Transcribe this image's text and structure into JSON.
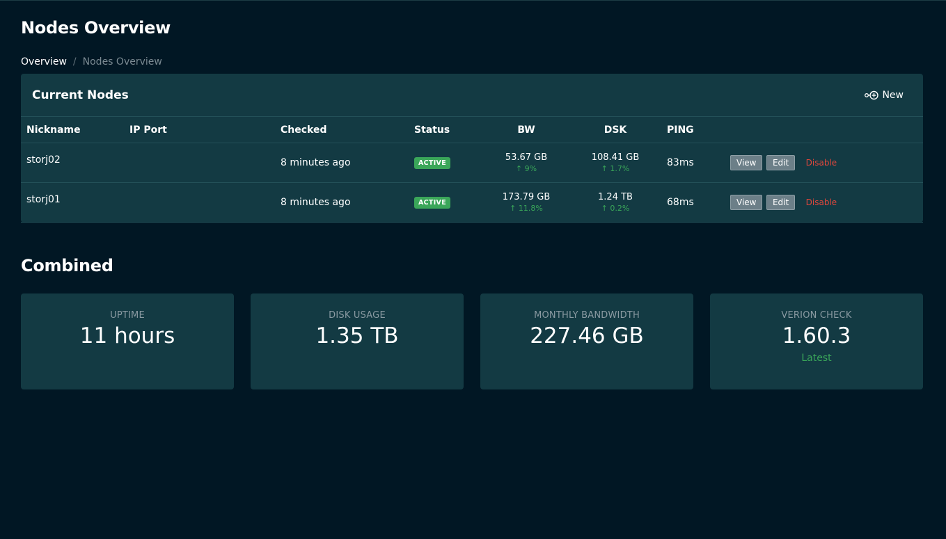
{
  "header": {
    "title": "Nodes Overview"
  },
  "breadcrumb": {
    "home": "Overview",
    "separator": "/",
    "current": "Nodes Overview"
  },
  "nodes_card": {
    "title": "Current Nodes",
    "new_label": "New",
    "columns": {
      "nickname": "Nickname",
      "ip_port": "IP Port",
      "checked": "Checked",
      "status": "Status",
      "bw": "BW",
      "dsk": "DSK",
      "ping": "PING"
    },
    "rows": [
      {
        "nickname": "storj02",
        "ip_port": "",
        "checked": "8 minutes ago",
        "status": "ACTIVE",
        "bw": "53.67 GB",
        "bw_change": "↑ 9%",
        "dsk": "108.41 GB",
        "dsk_change": "↑ 1.7%",
        "ping": "83ms",
        "view": "View",
        "edit": "Edit",
        "disable": "Disable"
      },
      {
        "nickname": "storj01",
        "ip_port": "",
        "checked": "8 minutes ago",
        "status": "ACTIVE",
        "bw": "173.79 GB",
        "bw_change": "↑ 11.8%",
        "dsk": "1.24 TB",
        "dsk_change": "↑ 0.2%",
        "ping": "68ms",
        "view": "View",
        "edit": "Edit",
        "disable": "Disable"
      }
    ]
  },
  "combined": {
    "title": "Combined",
    "stats": [
      {
        "label": "UPTIME",
        "value": "11 hours",
        "sub": ""
      },
      {
        "label": "DISK USAGE",
        "value": "1.35 TB",
        "sub": ""
      },
      {
        "label": "MONTHLY BANDWIDTH",
        "value": "227.46 GB",
        "sub": ""
      },
      {
        "label": "VERION CHECK",
        "value": "1.60.3",
        "sub": "Latest"
      }
    ]
  },
  "colors": {
    "background": "#011724",
    "card": "#133a43",
    "success": "#3aa659",
    "danger": "#e0473c"
  }
}
